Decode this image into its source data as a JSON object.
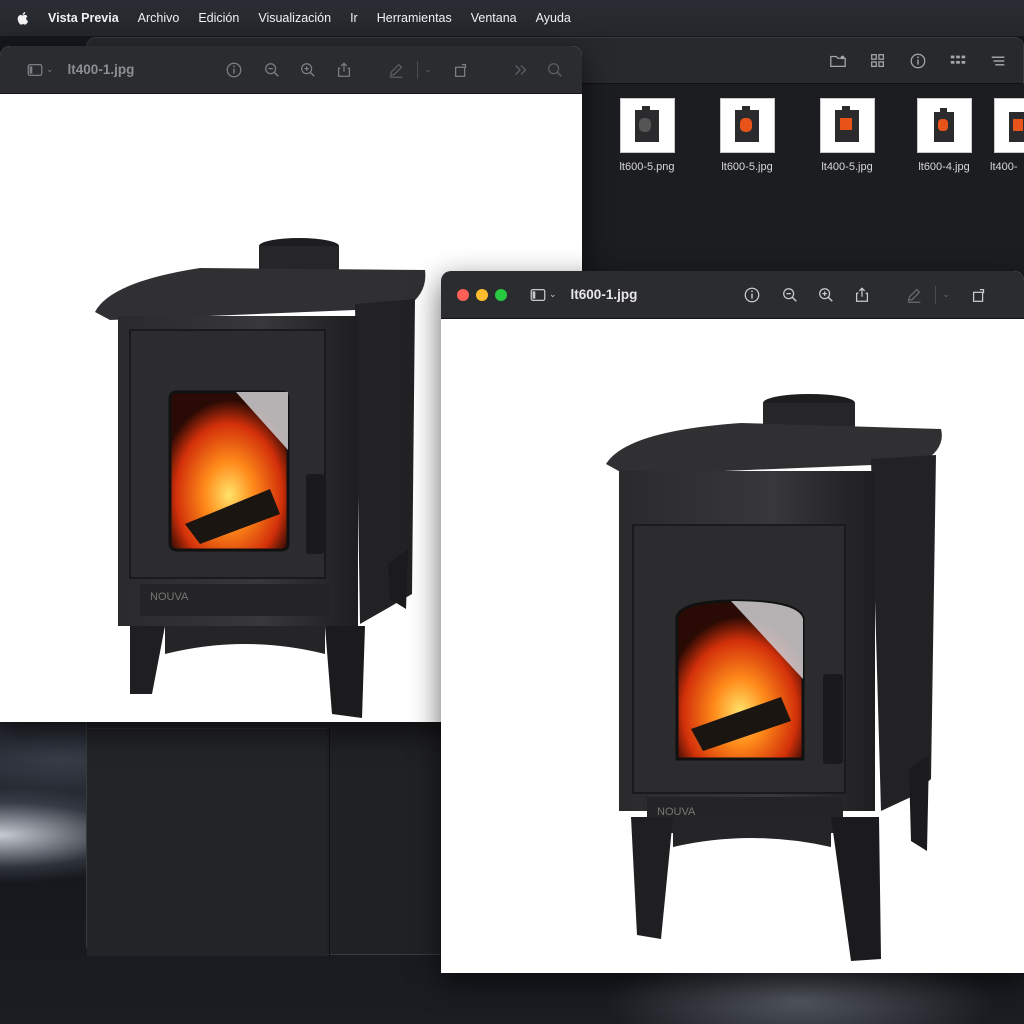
{
  "menubar": {
    "app_name": "Vista Previa",
    "items": [
      "Archivo",
      "Edición",
      "Visualización",
      "Ir",
      "Herramientas",
      "Ventana",
      "Ayuda"
    ]
  },
  "finder": {
    "thumbnails": [
      {
        "label": "lt600-5.png"
      },
      {
        "label": "lt600-5.jpg"
      },
      {
        "label": "lt400-5.jpg"
      },
      {
        "label": "lt600-4.jpg"
      },
      {
        "label": "lt400-"
      }
    ]
  },
  "preview_back": {
    "title": "lt400-1.jpg",
    "icons": [
      "sidebar-icon",
      "info-icon",
      "zoom-out-icon",
      "zoom-in-icon",
      "share-icon",
      "markup-icon",
      "rotate-icon",
      "more-icon",
      "search-icon"
    ]
  },
  "preview_front": {
    "title": "lt600-1.jpg",
    "icons": [
      "sidebar-icon",
      "info-icon",
      "zoom-out-icon",
      "zoom-in-icon",
      "share-icon",
      "markup-icon",
      "rotate-icon"
    ]
  },
  "stove": {
    "brand": "NOUVA"
  },
  "colors": {
    "traffic_red": "#fe5f57",
    "traffic_yellow": "#febc2e",
    "traffic_green": "#28c840",
    "toolbar_bg": "#2b2c30"
  }
}
